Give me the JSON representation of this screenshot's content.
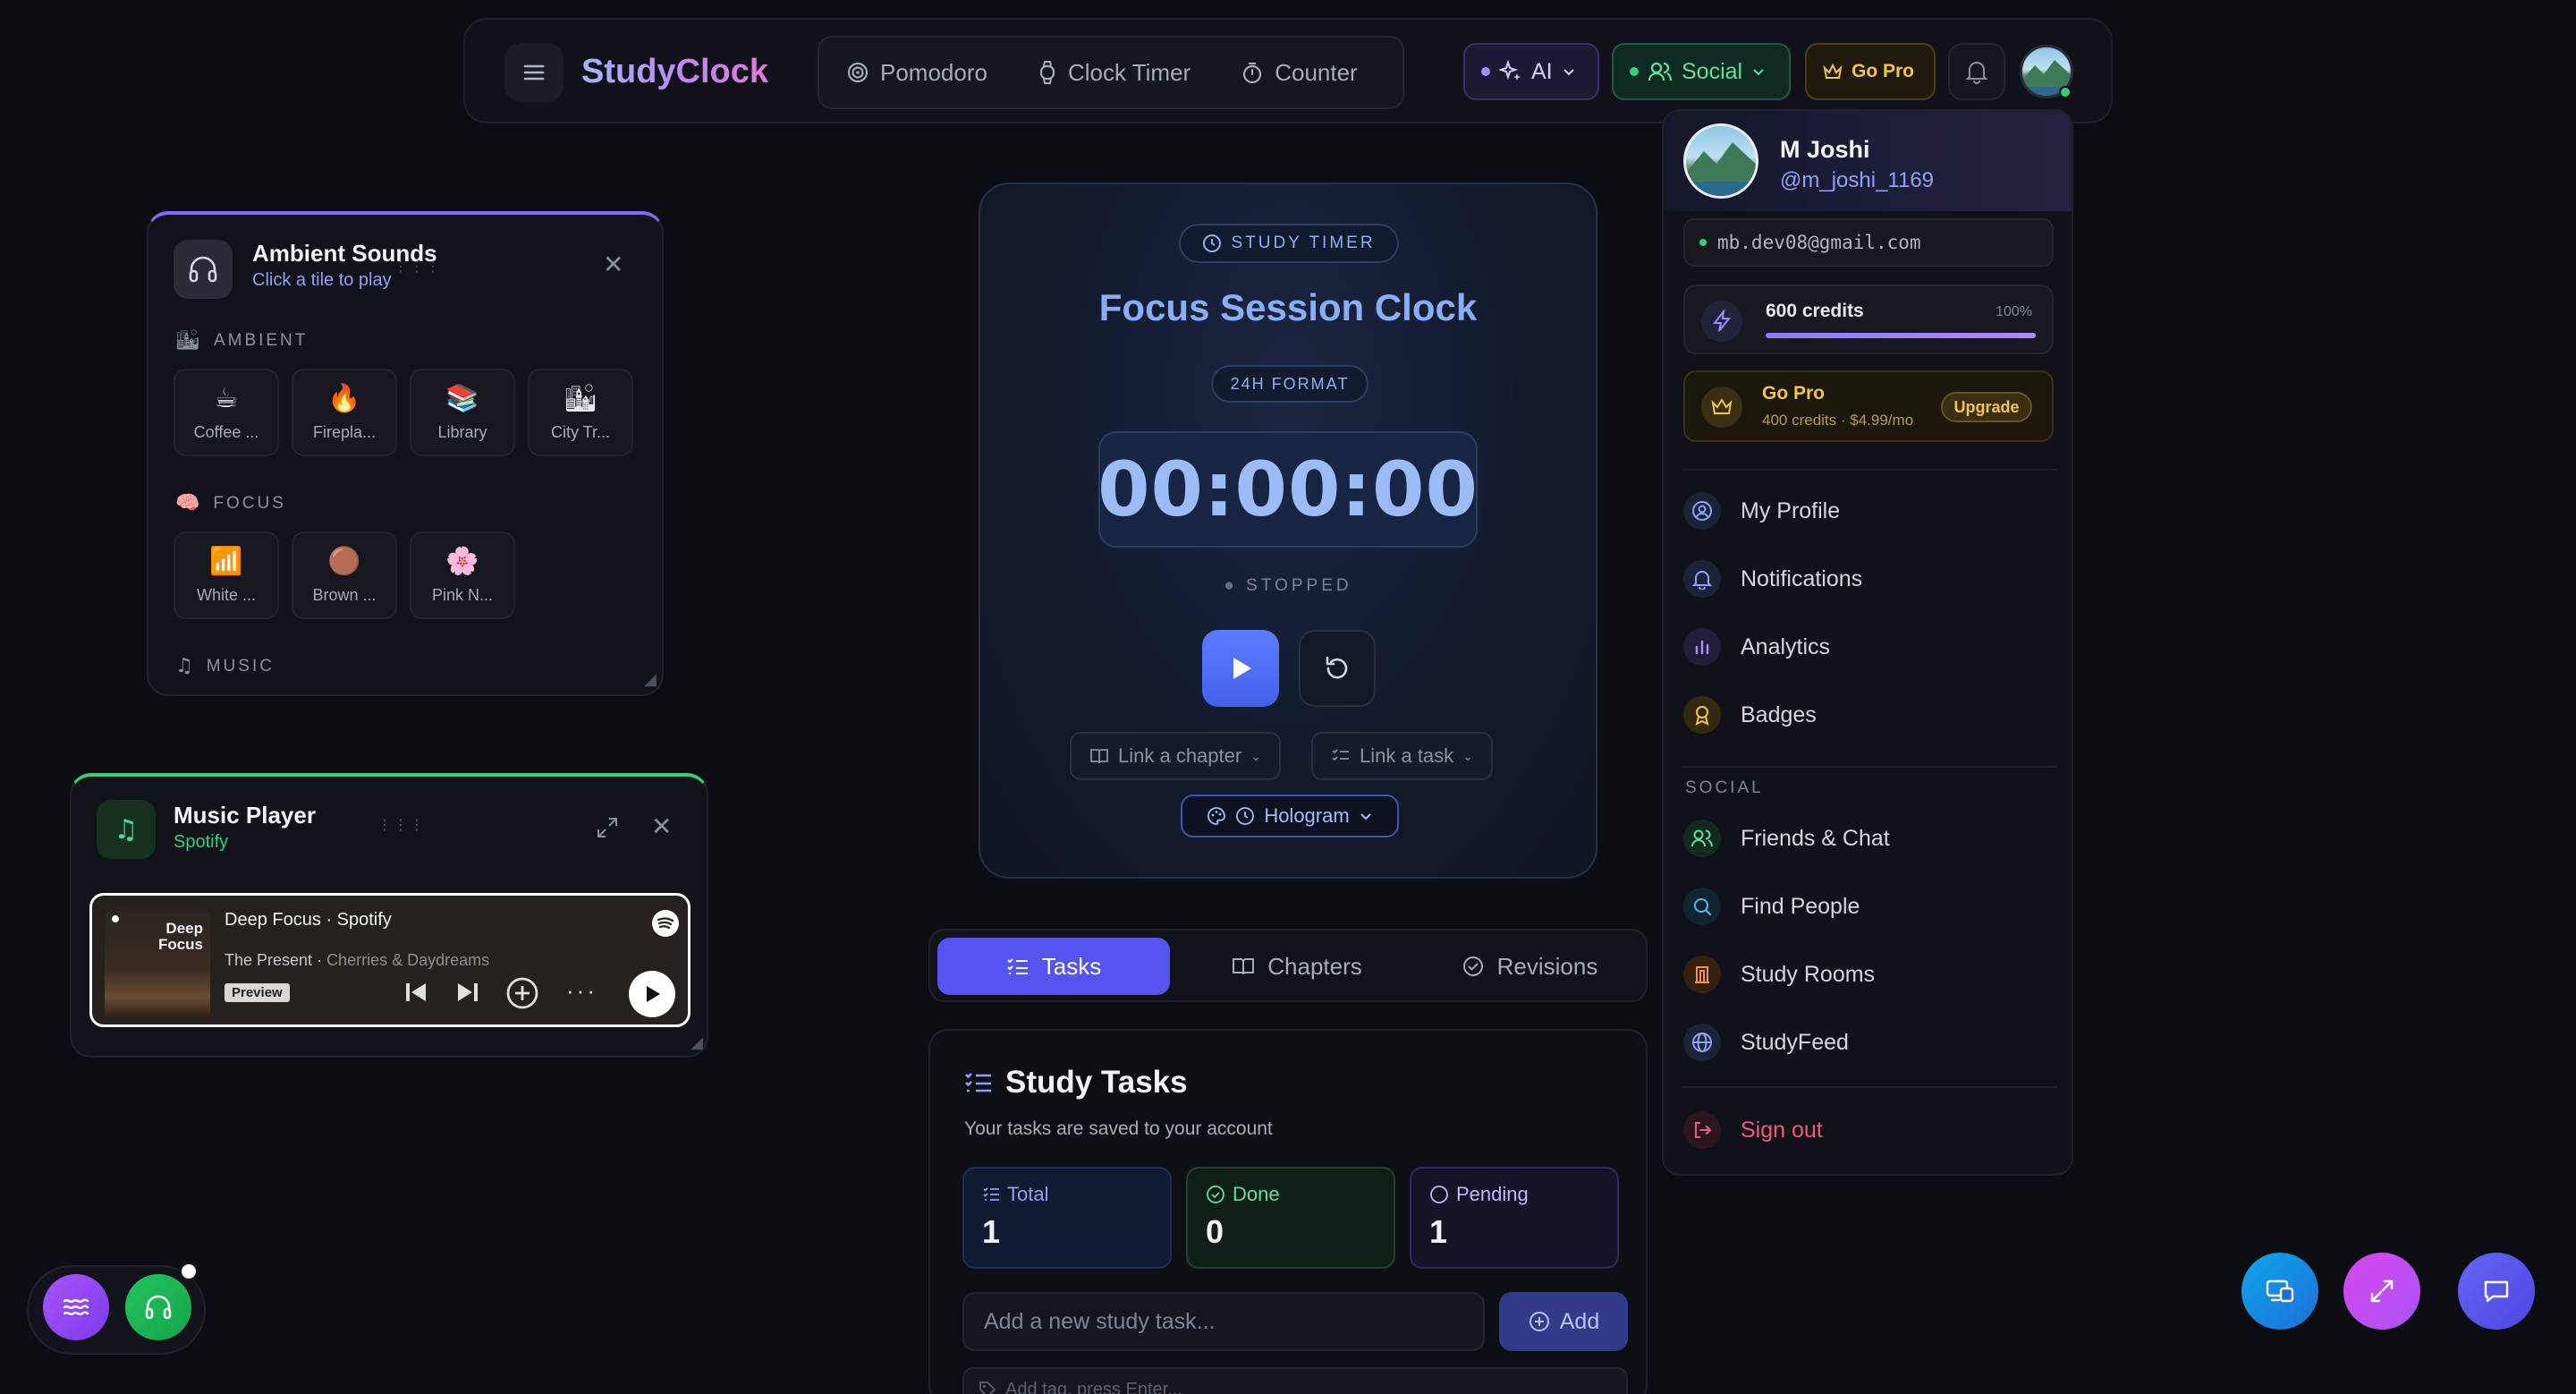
{
  "nav": {
    "brand": "StudyClock",
    "modes": [
      "Pomodoro",
      "Clock Timer",
      "Counter"
    ],
    "ai_label": "AI",
    "social_label": "Social",
    "pro_label": "Go Pro"
  },
  "ambient": {
    "title": "Ambient Sounds",
    "subtitle": "Click a tile to play",
    "sections": {
      "ambient": "AMBIENT",
      "focus": "FOCUS",
      "music": "MUSIC"
    },
    "ambient_tiles": [
      {
        "emoji": "☕",
        "label": "Coffee ..."
      },
      {
        "emoji": "🔥",
        "label": "Firepla..."
      },
      {
        "emoji": "📚",
        "label": "Library"
      },
      {
        "emoji": "🏙",
        "label": "City Tr..."
      }
    ],
    "focus_tiles": [
      {
        "emoji": "📶",
        "label": "White ..."
      },
      {
        "emoji": "🟤",
        "label": "Brown ..."
      },
      {
        "emoji": "🌸",
        "label": "Pink N..."
      }
    ]
  },
  "music": {
    "title": "Music Player",
    "subtitle": "Spotify",
    "embed": {
      "cover_text": "Deep Focus",
      "playlist": "Deep Focus",
      "service": "Spotify",
      "track": "The Present",
      "artist": "Cherries & Daydreams",
      "badge": "Preview"
    }
  },
  "timer": {
    "chip": "STUDY TIMER",
    "title": "Focus Session Clock",
    "format": "24H FORMAT",
    "time": "00:00:00",
    "status": "STOPPED",
    "link_chapter": "Link a chapter",
    "link_task": "Link a task",
    "theme": "Hologram"
  },
  "tabs": [
    "Tasks",
    "Chapters",
    "Revisions"
  ],
  "tasks": {
    "title": "Study Tasks",
    "subtitle": "Your tasks are saved to your account",
    "stats": [
      {
        "label": "Total",
        "value": "1"
      },
      {
        "label": "Done",
        "value": "0"
      },
      {
        "label": "Pending",
        "value": "1"
      }
    ],
    "input_placeholder": "Add a new study task...",
    "add_label": "Add",
    "tag_placeholder": "Add tag, press Enter..."
  },
  "profile": {
    "name": "M Joshi",
    "handle": "@m_joshi_1169",
    "email": "mb.dev08@gmail.com",
    "credits": "600 credits",
    "credits_pct": "100%",
    "credits_fill": 1.0,
    "pro_title": "Go Pro",
    "pro_sub": "400 credits · $4.99/mo",
    "upgrade": "Upgrade",
    "menu": [
      "My Profile",
      "Notifications",
      "Analytics",
      "Badges"
    ],
    "social_label": "SOCIAL",
    "social_menu": [
      "Friends & Chat",
      "Find People",
      "Study Rooms",
      "StudyFeed"
    ],
    "signout": "Sign out"
  },
  "colors": {
    "accent": "#5454ee",
    "social_green": "#5ee0a0",
    "gold": "#f5c542",
    "danger": "#f05a7e"
  }
}
